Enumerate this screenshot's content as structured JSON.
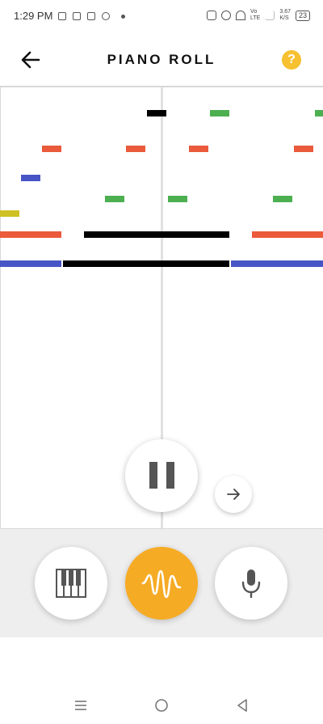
{
  "status": {
    "time": "1:29 PM",
    "net_speed": "3.67",
    "net_unit": "K/S",
    "volte_top": "Vo",
    "volte_bottom": "LTE",
    "battery": "23"
  },
  "header": {
    "title": "PIANO ROLL",
    "help": "?"
  },
  "colors": {
    "accent": "#f6ab25",
    "help": "#f6c030",
    "red": "#ea5a3b",
    "green": "#4caf50",
    "blue": "#4755c5",
    "black": "#000000",
    "yellow": "#cfc123"
  },
  "notes": [
    {
      "color": "black",
      "pitch": 1,
      "start": 182,
      "end": 206
    },
    {
      "color": "green",
      "pitch": 1,
      "start": 260,
      "end": 284
    },
    {
      "color": "green",
      "pitch": 1,
      "start": 390,
      "end": 400
    },
    {
      "color": "red",
      "pitch": 2,
      "start": 52,
      "end": 76
    },
    {
      "color": "red",
      "pitch": 2,
      "start": 156,
      "end": 180
    },
    {
      "color": "red",
      "pitch": 2,
      "start": 234,
      "end": 258
    },
    {
      "color": "red",
      "pitch": 2,
      "start": 364,
      "end": 388
    },
    {
      "color": "blue",
      "pitch": 3,
      "start": 26,
      "end": 50
    },
    {
      "color": "green",
      "pitch": 4,
      "start": 130,
      "end": 154
    },
    {
      "color": "green",
      "pitch": 4,
      "start": 208,
      "end": 232
    },
    {
      "color": "green",
      "pitch": 4,
      "start": 338,
      "end": 362
    },
    {
      "color": "yellow",
      "pitch": 5,
      "start": 0,
      "end": 24
    },
    {
      "color": "red",
      "pitch": 6,
      "start": 0,
      "end": 76
    },
    {
      "color": "black",
      "pitch": 6,
      "start": 104,
      "end": 284
    },
    {
      "color": "red",
      "pitch": 6,
      "start": 312,
      "end": 400
    },
    {
      "color": "blue",
      "pitch": 7,
      "start": 0,
      "end": 76
    },
    {
      "color": "black",
      "pitch": 7,
      "start": 78,
      "end": 284
    },
    {
      "color": "blue",
      "pitch": 7,
      "start": 286,
      "end": 400
    }
  ],
  "controls": {
    "pause_icon": "pause-icon",
    "next_icon": "arrow-right-icon"
  },
  "tools": [
    {
      "name": "piano",
      "icon": "piano-keys-icon"
    },
    {
      "name": "wave",
      "icon": "waveform-icon",
      "active": true
    },
    {
      "name": "mic",
      "icon": "microphone-icon"
    }
  ],
  "nav": [
    "menu-icon",
    "home-icon",
    "back-triangle-icon"
  ]
}
